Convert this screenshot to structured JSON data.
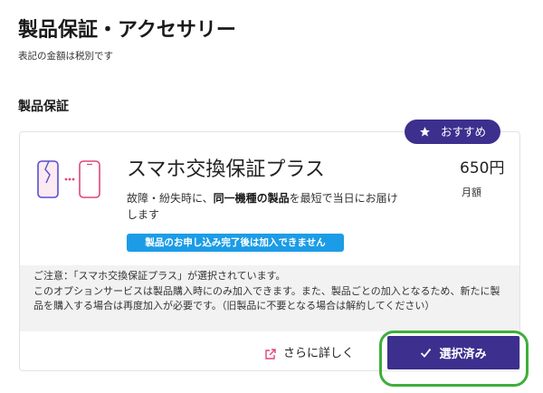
{
  "page": {
    "title": "製品保証・アクセサリー",
    "tax_note": "表記の金額は税別です"
  },
  "section": {
    "heading": "製品保証"
  },
  "product": {
    "badge": {
      "icon": "star-icon",
      "label": "おすすめ"
    },
    "illustration": "phone-exchange-icon",
    "name": "スマホ交換保証プラス",
    "price": "650円",
    "price_period": "月額",
    "description": {
      "line1_pre": "故障・紛失時に、",
      "line1_bold": "同一機種の製品",
      "line1_post": "を最短で当日にお届け",
      "line2": "します"
    },
    "notice_tag": "製品のお申し込み完了後は加入できません",
    "caution_lines": [
      "ご注意：「スマホ交換保証プラス」が選択されています。",
      "このオプションサービスは製品購入時にのみ加入できます。また、製品ごとの加入となるため、新たに製",
      "品を購入する場合は再度加入が必要です。（旧製品に不要となる場合は解約してください）"
    ],
    "details_link": {
      "icon": "external-link-icon",
      "label": "さらに詳しく"
    },
    "select_button": {
      "icon": "check-icon",
      "label": "選択済み"
    }
  },
  "theme": {
    "accent": "#3d2f8e",
    "tag": "#1c9ce6",
    "link_icon": "#e0457b",
    "highlight": "#3fae3a",
    "band": "#f2f2f2",
    "phone_primary": "#5a4fcf",
    "phone_secondary": "#e0457b"
  }
}
